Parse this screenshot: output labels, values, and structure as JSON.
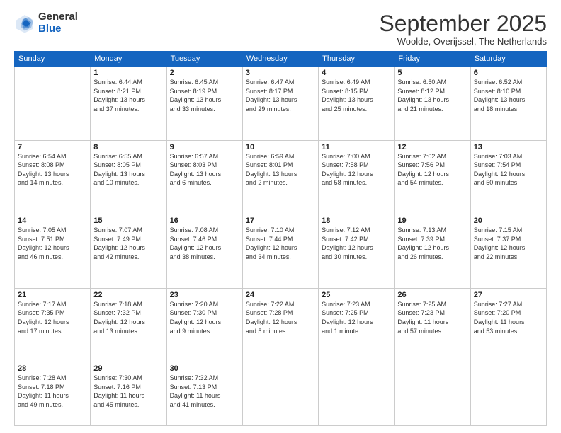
{
  "logo": {
    "general": "General",
    "blue": "Blue"
  },
  "title": "September 2025",
  "subtitle": "Woolde, Overijssel, The Netherlands",
  "days": [
    "Sunday",
    "Monday",
    "Tuesday",
    "Wednesday",
    "Thursday",
    "Friday",
    "Saturday"
  ],
  "weeks": [
    [
      {
        "day": "",
        "info": ""
      },
      {
        "day": "1",
        "info": "Sunrise: 6:44 AM\nSunset: 8:21 PM\nDaylight: 13 hours\nand 37 minutes."
      },
      {
        "day": "2",
        "info": "Sunrise: 6:45 AM\nSunset: 8:19 PM\nDaylight: 13 hours\nand 33 minutes."
      },
      {
        "day": "3",
        "info": "Sunrise: 6:47 AM\nSunset: 8:17 PM\nDaylight: 13 hours\nand 29 minutes."
      },
      {
        "day": "4",
        "info": "Sunrise: 6:49 AM\nSunset: 8:15 PM\nDaylight: 13 hours\nand 25 minutes."
      },
      {
        "day": "5",
        "info": "Sunrise: 6:50 AM\nSunset: 8:12 PM\nDaylight: 13 hours\nand 21 minutes."
      },
      {
        "day": "6",
        "info": "Sunrise: 6:52 AM\nSunset: 8:10 PM\nDaylight: 13 hours\nand 18 minutes."
      }
    ],
    [
      {
        "day": "7",
        "info": "Sunrise: 6:54 AM\nSunset: 8:08 PM\nDaylight: 13 hours\nand 14 minutes."
      },
      {
        "day": "8",
        "info": "Sunrise: 6:55 AM\nSunset: 8:05 PM\nDaylight: 13 hours\nand 10 minutes."
      },
      {
        "day": "9",
        "info": "Sunrise: 6:57 AM\nSunset: 8:03 PM\nDaylight: 13 hours\nand 6 minutes."
      },
      {
        "day": "10",
        "info": "Sunrise: 6:59 AM\nSunset: 8:01 PM\nDaylight: 13 hours\nand 2 minutes."
      },
      {
        "day": "11",
        "info": "Sunrise: 7:00 AM\nSunset: 7:58 PM\nDaylight: 12 hours\nand 58 minutes."
      },
      {
        "day": "12",
        "info": "Sunrise: 7:02 AM\nSunset: 7:56 PM\nDaylight: 12 hours\nand 54 minutes."
      },
      {
        "day": "13",
        "info": "Sunrise: 7:03 AM\nSunset: 7:54 PM\nDaylight: 12 hours\nand 50 minutes."
      }
    ],
    [
      {
        "day": "14",
        "info": "Sunrise: 7:05 AM\nSunset: 7:51 PM\nDaylight: 12 hours\nand 46 minutes."
      },
      {
        "day": "15",
        "info": "Sunrise: 7:07 AM\nSunset: 7:49 PM\nDaylight: 12 hours\nand 42 minutes."
      },
      {
        "day": "16",
        "info": "Sunrise: 7:08 AM\nSunset: 7:46 PM\nDaylight: 12 hours\nand 38 minutes."
      },
      {
        "day": "17",
        "info": "Sunrise: 7:10 AM\nSunset: 7:44 PM\nDaylight: 12 hours\nand 34 minutes."
      },
      {
        "day": "18",
        "info": "Sunrise: 7:12 AM\nSunset: 7:42 PM\nDaylight: 12 hours\nand 30 minutes."
      },
      {
        "day": "19",
        "info": "Sunrise: 7:13 AM\nSunset: 7:39 PM\nDaylight: 12 hours\nand 26 minutes."
      },
      {
        "day": "20",
        "info": "Sunrise: 7:15 AM\nSunset: 7:37 PM\nDaylight: 12 hours\nand 22 minutes."
      }
    ],
    [
      {
        "day": "21",
        "info": "Sunrise: 7:17 AM\nSunset: 7:35 PM\nDaylight: 12 hours\nand 17 minutes."
      },
      {
        "day": "22",
        "info": "Sunrise: 7:18 AM\nSunset: 7:32 PM\nDaylight: 12 hours\nand 13 minutes."
      },
      {
        "day": "23",
        "info": "Sunrise: 7:20 AM\nSunset: 7:30 PM\nDaylight: 12 hours\nand 9 minutes."
      },
      {
        "day": "24",
        "info": "Sunrise: 7:22 AM\nSunset: 7:28 PM\nDaylight: 12 hours\nand 5 minutes."
      },
      {
        "day": "25",
        "info": "Sunrise: 7:23 AM\nSunset: 7:25 PM\nDaylight: 12 hours\nand 1 minute."
      },
      {
        "day": "26",
        "info": "Sunrise: 7:25 AM\nSunset: 7:23 PM\nDaylight: 11 hours\nand 57 minutes."
      },
      {
        "day": "27",
        "info": "Sunrise: 7:27 AM\nSunset: 7:20 PM\nDaylight: 11 hours\nand 53 minutes."
      }
    ],
    [
      {
        "day": "28",
        "info": "Sunrise: 7:28 AM\nSunset: 7:18 PM\nDaylight: 11 hours\nand 49 minutes."
      },
      {
        "day": "29",
        "info": "Sunrise: 7:30 AM\nSunset: 7:16 PM\nDaylight: 11 hours\nand 45 minutes."
      },
      {
        "day": "30",
        "info": "Sunrise: 7:32 AM\nSunset: 7:13 PM\nDaylight: 11 hours\nand 41 minutes."
      },
      {
        "day": "",
        "info": ""
      },
      {
        "day": "",
        "info": ""
      },
      {
        "day": "",
        "info": ""
      },
      {
        "day": "",
        "info": ""
      }
    ]
  ]
}
